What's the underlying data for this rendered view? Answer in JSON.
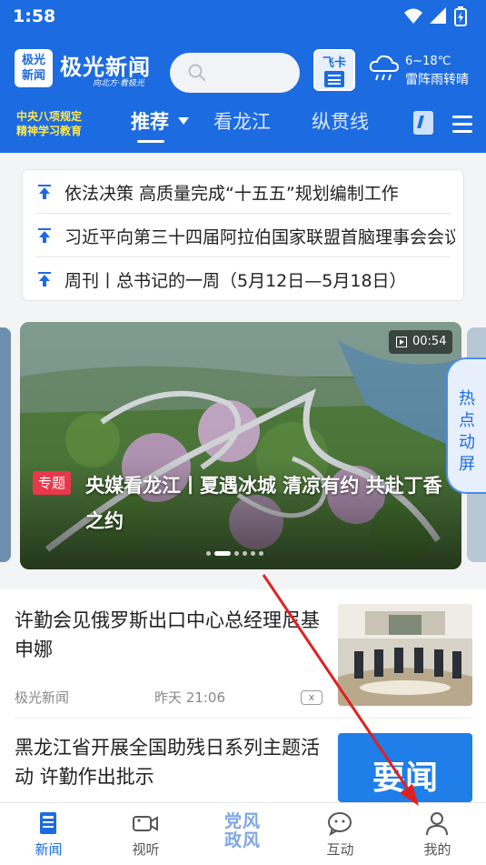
{
  "status_bar": {
    "time": "1:58"
  },
  "header": {
    "logo_text": "极光\n新闻",
    "brand": "极光新闻",
    "slogan": "向北方·看极光",
    "feika_label": "飞卡",
    "weather": {
      "temp": "6~18℃",
      "desc": "雷阵雨转晴"
    },
    "promo_line1": "中央八项规定",
    "promo_line2": "精神学习教育",
    "tabs": [
      {
        "label": "推荐",
        "active": true
      },
      {
        "label": "看龙江",
        "active": false
      },
      {
        "label": "纵贯线",
        "active": false
      }
    ]
  },
  "headlines": [
    "依法决策 高质量完成“十五五”规划编制工作",
    "习近平向第三十四届阿拉伯国家联盟首脑理事会会议主席",
    "周刊丨总书记的一周（5月12日—5月18日）"
  ],
  "carousel": {
    "tag": "专题",
    "title": "央媒看龙江丨夏遇冰城 清凉有约 共赴丁香之约",
    "video_duration": "00:54",
    "slide_count": 6,
    "active_slide": 1
  },
  "hot_tab": "热点动屏",
  "news": [
    {
      "title": "许勤会见俄罗斯出口中心总经理尼基申娜",
      "source": "极光新闻",
      "time": "昨天 21:06",
      "dismiss": "x"
    },
    {
      "title": "黑龙江省开展全国助残日系列主题活动 许勤作出批示",
      "thumb_text": "要闻"
    }
  ],
  "bottom_nav": [
    {
      "label": "新闻",
      "icon": "news-icon",
      "active": true
    },
    {
      "label": "视听",
      "icon": "video-icon",
      "active": false
    },
    {
      "label": "党风政风",
      "icon": "dangfeng-logo",
      "active": false
    },
    {
      "label": "互动",
      "icon": "chat-icon",
      "active": false
    },
    {
      "label": "我的",
      "icon": "user-icon",
      "active": false
    }
  ],
  "colors": {
    "brand_blue": "#1c6be0",
    "promo_yellow": "#ffe74d",
    "tag_red": "#e8394a",
    "arrow_red": "#e02020"
  }
}
